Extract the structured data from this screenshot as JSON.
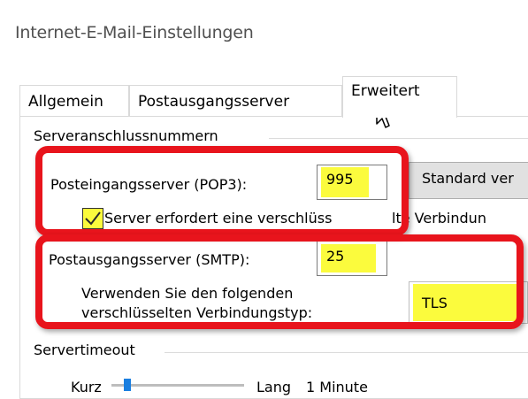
{
  "window": {
    "title": "Internet-E-Mail-Einstellungen"
  },
  "tabs": [
    {
      "label": "Allgemein"
    },
    {
      "label": "Postausgangsserver"
    },
    {
      "label": "Erweitert"
    }
  ],
  "ports_group": {
    "legend": "Serveranschlussnummern",
    "pop3_label": "Posteingangsserver (POP3):",
    "pop3_value": "995",
    "standard_button": "Standard ver",
    "ssl_checkbox_label_a": "Server erfordert eine verschlüss",
    "ssl_checkbox_label_b": "lte Verbindun",
    "ssl_checked": true,
    "smtp_label": "Postausgangsserver (SMTP):",
    "smtp_value": "25",
    "enc_label_line1": "Verwenden Sie den folgenden",
    "enc_label_line2": "verschlüsselten Verbindungstyp:",
    "enc_value": "TLS"
  },
  "timeout_group": {
    "legend": "Servertimeout",
    "short_label": "Kurz",
    "long_label": "Lang",
    "value_text": "1 Minute"
  },
  "colors": {
    "highlight": "#fbfb3d",
    "annotation_red": "#e8141c"
  }
}
